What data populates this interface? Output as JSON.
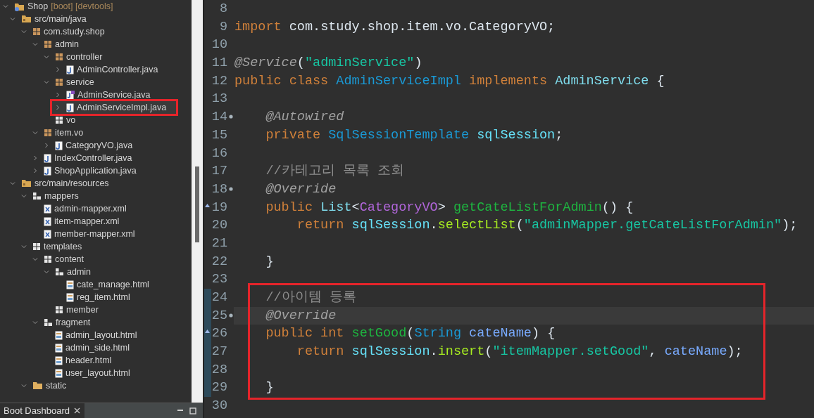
{
  "explorer": {
    "tree": [
      {
        "label": "Shop",
        "decoration": "[boot] [devtools]",
        "kind": "project",
        "expanded": true,
        "highlighted": false,
        "children": [
          {
            "label": "src/main/java",
            "kind": "source-folder",
            "expanded": true,
            "highlighted": false,
            "children": [
              {
                "label": "com.study.shop",
                "kind": "package",
                "expanded": true,
                "highlighted": false,
                "children": [
                  {
                    "label": "admin",
                    "kind": "package",
                    "expanded": true,
                    "highlighted": false,
                    "children": [
                      {
                        "label": "controller",
                        "kind": "package",
                        "expanded": true,
                        "highlighted": false,
                        "children": [
                          {
                            "label": "AdminController.java",
                            "kind": "java",
                            "expanded": false,
                            "highlighted": false
                          }
                        ]
                      },
                      {
                        "label": "service",
                        "kind": "package",
                        "expanded": true,
                        "highlighted": false,
                        "children": [
                          {
                            "label": "AdminService.java",
                            "kind": "java-interface",
                            "expanded": false,
                            "highlighted": false
                          },
                          {
                            "label": "AdminServiceImpl.java",
                            "kind": "java",
                            "expanded": false,
                            "highlighted": true
                          }
                        ]
                      },
                      {
                        "label": "vo",
                        "kind": "empty-package",
                        "highlighted": false
                      }
                    ]
                  },
                  {
                    "label": "item.vo",
                    "kind": "package",
                    "expanded": true,
                    "highlighted": false,
                    "children": [
                      {
                        "label": "CategoryVO.java",
                        "kind": "java",
                        "expanded": false,
                        "highlighted": false
                      }
                    ]
                  },
                  {
                    "label": "IndexController.java",
                    "kind": "java",
                    "expanded": false,
                    "highlighted": false
                  },
                  {
                    "label": "ShopApplication.java",
                    "kind": "java",
                    "expanded": false,
                    "highlighted": false
                  }
                ]
              }
            ]
          },
          {
            "label": "src/main/resources",
            "kind": "source-folder",
            "expanded": true,
            "highlighted": false,
            "children": [
              {
                "label": "mappers",
                "kind": "resource-folder",
                "expanded": true,
                "highlighted": false,
                "children": [
                  {
                    "label": "admin-mapper.xml",
                    "kind": "xml",
                    "highlighted": false
                  },
                  {
                    "label": "item-mapper.xml",
                    "kind": "xml",
                    "highlighted": false
                  },
                  {
                    "label": "member-mapper.xml",
                    "kind": "xml",
                    "highlighted": false
                  }
                ]
              },
              {
                "label": "templates",
                "kind": "empty-package",
                "expanded": true,
                "highlighted": false,
                "children": [
                  {
                    "label": "content",
                    "kind": "empty-package",
                    "expanded": true,
                    "highlighted": false,
                    "children": [
                      {
                        "label": "admin",
                        "kind": "resource-folder",
                        "expanded": true,
                        "highlighted": false,
                        "children": [
                          {
                            "label": "cate_manage.html",
                            "kind": "html",
                            "highlighted": false
                          },
                          {
                            "label": "reg_item.html",
                            "kind": "html",
                            "highlighted": false
                          }
                        ]
                      },
                      {
                        "label": "member",
                        "kind": "empty-package",
                        "highlighted": false
                      }
                    ]
                  },
                  {
                    "label": "fragment",
                    "kind": "resource-folder",
                    "expanded": true,
                    "highlighted": false,
                    "children": [
                      {
                        "label": "admin_layout.html",
                        "kind": "html",
                        "highlighted": false
                      },
                      {
                        "label": "admin_side.html",
                        "kind": "html",
                        "highlighted": false
                      },
                      {
                        "label": "header.html",
                        "kind": "html",
                        "highlighted": false
                      },
                      {
                        "label": "user_layout.html",
                        "kind": "html",
                        "highlighted": false
                      }
                    ]
                  }
                ]
              },
              {
                "label": "static",
                "kind": "folder",
                "expanded": true,
                "highlighted": false
              }
            ]
          }
        ]
      }
    ]
  },
  "bottom_panel": {
    "tab": "Boot Dashboard"
  },
  "editor": {
    "sections": [
      {
        "highlighted": false,
        "lines": [
          {
            "number": "8",
            "kind": "code"
          },
          {
            "number": "9",
            "kind": "code",
            "tokens": [
              {
                "text": "import",
                "kind": "keyword"
              },
              {
                "text": " com.study.shop.item.vo.CategoryVO;",
                "kind": "plain"
              }
            ]
          },
          {
            "number": "10",
            "kind": "code"
          },
          {
            "number": "11",
            "kind": "code",
            "tokens": [
              {
                "text": "@Service",
                "kind": "annotation"
              },
              {
                "text": "(",
                "kind": "plain"
              },
              {
                "text": "\"adminService\"",
                "kind": "string"
              },
              {
                "text": ")",
                "kind": "plain"
              }
            ]
          },
          {
            "number": "12",
            "kind": "code",
            "tokens": [
              {
                "text": "public class",
                "kind": "keyword"
              },
              {
                "text": " AdminServiceImpl",
                "kind": "class"
              },
              {
                "text": " implements",
                "kind": "keyword"
              },
              {
                "text": " AdminService",
                "kind": "interface"
              },
              {
                "text": " {",
                "kind": "plain"
              }
            ]
          },
          {
            "number": "13",
            "kind": "code"
          },
          {
            "number": "14",
            "kind": "fold",
            "tokens": [
              {
                "text": "    @Autowired",
                "kind": "annotation"
              }
            ]
          },
          {
            "number": "15",
            "kind": "code",
            "tokens": [
              {
                "text": "    private",
                "kind": "keyword"
              },
              {
                "text": " SqlSessionTemplate",
                "kind": "class"
              },
              {
                "text": " sqlSession",
                "kind": "field"
              },
              {
                "text": ";",
                "kind": "plain"
              }
            ]
          },
          {
            "number": "16",
            "kind": "code"
          },
          {
            "number": "17",
            "kind": "code",
            "tokens": [
              {
                "text": "    //카테고리 목록 조회",
                "kind": "comment"
              }
            ]
          },
          {
            "number": "18",
            "kind": "fold",
            "tokens": [
              {
                "text": "    @Override",
                "kind": "annotation"
              }
            ]
          },
          {
            "number": "19",
            "kind": "override",
            "tokens": [
              {
                "text": "    public",
                "kind": "keyword"
              },
              {
                "text": " List",
                "kind": "interface"
              },
              {
                "text": "<",
                "kind": "plain"
              },
              {
                "text": "CategoryVO",
                "kind": "generic"
              },
              {
                "text": "> ",
                "kind": "plain"
              },
              {
                "text": "getCateListForAdmin",
                "kind": "method-decl"
              },
              {
                "text": "() {",
                "kind": "plain"
              }
            ]
          },
          {
            "number": "20",
            "kind": "code",
            "tokens": [
              {
                "text": "        return",
                "kind": "keyword"
              },
              {
                "text": " sqlSession",
                "kind": "field"
              },
              {
                "text": ".",
                "kind": "plain"
              },
              {
                "text": "selectList",
                "kind": "method-call"
              },
              {
                "text": "(",
                "kind": "plain"
              },
              {
                "text": "\"adminMapper.getCateListForAdmin\"",
                "kind": "string"
              },
              {
                "text": ");",
                "kind": "plain"
              }
            ]
          },
          {
            "number": "21",
            "kind": "code"
          },
          {
            "number": "22",
            "kind": "code",
            "tokens": [
              {
                "text": "    }",
                "kind": "plain"
              }
            ]
          },
          {
            "number": "23",
            "kind": "code"
          }
        ]
      },
      {
        "highlighted": true,
        "lines": [
          {
            "number": "24",
            "kind": "code",
            "changed": true,
            "current": false,
            "tokens": [
              {
                "text": "    //아이템 등록",
                "kind": "comment"
              }
            ]
          },
          {
            "number": "25",
            "kind": "fold",
            "changed": true,
            "current": true,
            "tokens": [
              {
                "text": "    @Override",
                "kind": "annotation"
              }
            ]
          },
          {
            "number": "26",
            "kind": "override",
            "changed": true,
            "current": false,
            "tokens": [
              {
                "text": "    public int",
                "kind": "keyword"
              },
              {
                "text": " setGood",
                "kind": "method-decl"
              },
              {
                "text": "(",
                "kind": "plain"
              },
              {
                "text": "String",
                "kind": "class"
              },
              {
                "text": " cateName",
                "kind": "param"
              },
              {
                "text": ") {",
                "kind": "plain"
              }
            ]
          },
          {
            "number": "27",
            "kind": "code",
            "changed": true,
            "current": false,
            "tokens": [
              {
                "text": "        return",
                "kind": "keyword"
              },
              {
                "text": " sqlSession",
                "kind": "field"
              },
              {
                "text": ".",
                "kind": "plain"
              },
              {
                "text": "insert",
                "kind": "method-call"
              },
              {
                "text": "(",
                "kind": "plain"
              },
              {
                "text": "\"itemMapper.setGood\"",
                "kind": "string"
              },
              {
                "text": ",",
                "kind": "plain"
              },
              {
                "text": " cateName",
                "kind": "param"
              },
              {
                "text": ");",
                "kind": "plain"
              }
            ]
          },
          {
            "number": "28",
            "kind": "code",
            "changed": true,
            "current": false
          },
          {
            "number": "29",
            "kind": "code",
            "changed": true,
            "current": false,
            "tokens": [
              {
                "text": "    }",
                "kind": "plain"
              }
            ]
          }
        ]
      },
      {
        "highlighted": false,
        "lines": [
          {
            "number": "30",
            "kind": "code"
          }
        ]
      }
    ]
  }
}
